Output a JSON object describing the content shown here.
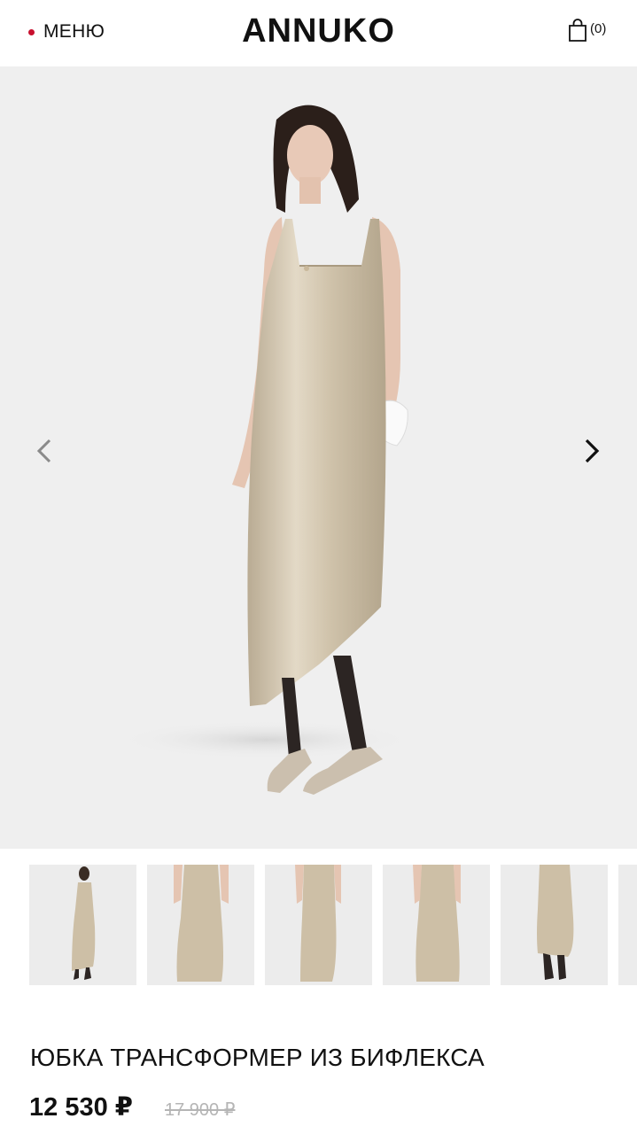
{
  "header": {
    "menu_label": "МЕНЮ",
    "logo": "ANNUKO",
    "cart_count": "(0)",
    "accent_color": "#c8102e"
  },
  "gallery": {
    "background": "#efefef",
    "prev_icon": "chevron-left-icon",
    "next_icon": "chevron-right-icon",
    "thumbnail_count": 6
  },
  "product": {
    "title": "ЮБКА ТРАНСФОРМЕР ИЗ БИФЛЕКСА",
    "price": "12 530 ₽",
    "old_price": "17 900 ₽"
  }
}
